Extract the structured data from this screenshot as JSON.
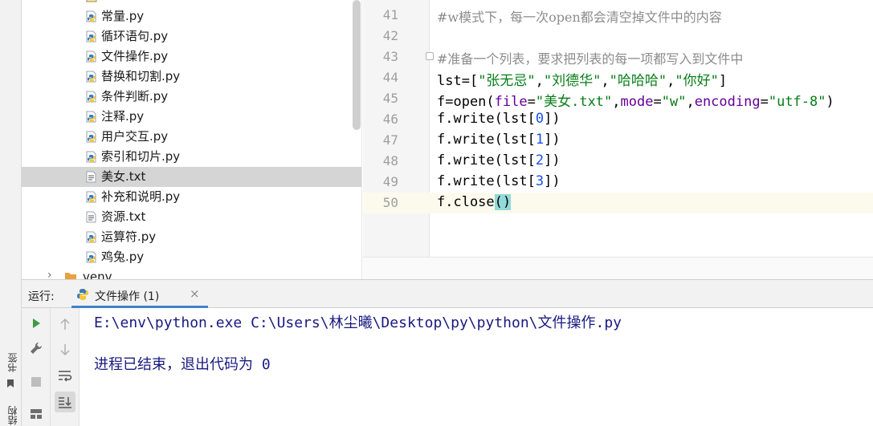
{
  "sidebar": {
    "bookmarks_label": "书签",
    "structure_label": "结构"
  },
  "project_tree": {
    "items": [
      {
        "name": "常量.py",
        "type": "py"
      },
      {
        "name": "循环语句.py",
        "type": "py"
      },
      {
        "name": "文件操作.py",
        "type": "py"
      },
      {
        "name": "替换和切割.py",
        "type": "py"
      },
      {
        "name": "条件判断.py",
        "type": "py"
      },
      {
        "name": "注释.py",
        "type": "py"
      },
      {
        "name": "用户交互.py",
        "type": "py"
      },
      {
        "name": "索引和切片.py",
        "type": "py"
      },
      {
        "name": "美女.txt",
        "type": "txt",
        "selected": true
      },
      {
        "name": "补充和说明.py",
        "type": "py"
      },
      {
        "name": "资源.txt",
        "type": "txt"
      },
      {
        "name": "运算符.py",
        "type": "py"
      },
      {
        "name": "鸡兔.py",
        "type": "py"
      }
    ],
    "folder": "venv"
  },
  "editor": {
    "line_numbers": [
      "41",
      "42",
      "43",
      "44",
      "45",
      "46",
      "47",
      "48",
      "49",
      "50"
    ],
    "lines": {
      "l41_comment": "#w模式下，每一次open都会清空掉文件中的内容",
      "l43_comment": "#准备一个列表，要求把列表的每一项都写入到文件中",
      "l44_a": "lst=[",
      "l44_s1": "\"张无忌\"",
      "l44_c1": ",",
      "l44_s2": "\"刘德华\"",
      "l44_c2": ",",
      "l44_s3": "\"哈哈哈\"",
      "l44_c3": ",",
      "l44_s4": "\"你好\"",
      "l44_b": "]",
      "l45_a": "f=open(",
      "l45_p1": "file",
      "l45_eq1": "=",
      "l45_s1": "\"美女.txt\"",
      "l45_c1": ",",
      "l45_p2": "mode",
      "l45_eq2": "=",
      "l45_s2": "\"w\"",
      "l45_c2": ",",
      "l45_p3": "encoding",
      "l45_eq3": "=",
      "l45_s3": "\"utf-8\"",
      "l45_b": ")",
      "write_prefix": "f.write(lst[",
      "write_suffix": "])",
      "idx0": "0",
      "idx1": "1",
      "idx2": "2",
      "idx3": "3",
      "l50_a": "f.close",
      "l50_b": "()"
    }
  },
  "run": {
    "label": "运行:",
    "tab_label": "文件操作 (1)",
    "tab_close": "×",
    "console_cmd": "E:\\env\\python.exe C:\\Users\\林尘曦\\Desktop\\py\\python\\文件操作.py",
    "console_exit": "进程已结束，退出代码为 0"
  },
  "colors": {
    "accent": "#4083c9",
    "string": "#067d17",
    "number": "#1750eb",
    "param": "#660099",
    "run_green": "#3e9b3e"
  }
}
